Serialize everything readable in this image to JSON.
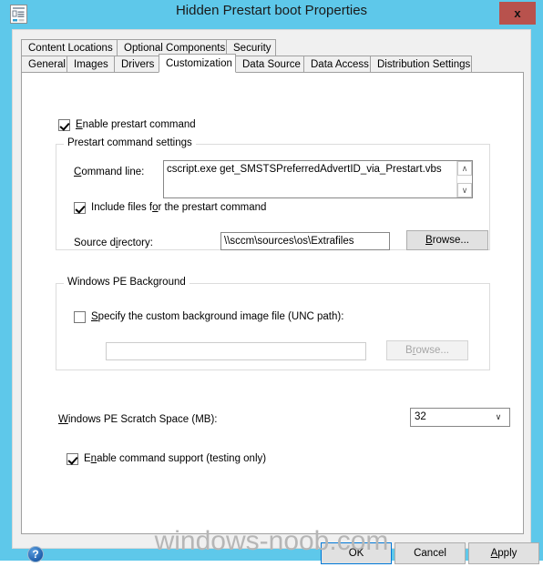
{
  "window": {
    "title": "Hidden Prestart boot Properties",
    "icon": "properties-document-icon",
    "close_label": "x",
    "titlebar_color": "#5ec8ea",
    "close_button_color": "#b8524d"
  },
  "tabs": {
    "row1": [
      {
        "label": "Content Locations",
        "selected": false
      },
      {
        "label": "Optional Components",
        "selected": false
      },
      {
        "label": "Security",
        "selected": false
      }
    ],
    "row2": [
      {
        "label": "General",
        "selected": false
      },
      {
        "label": "Images",
        "selected": false
      },
      {
        "label": "Drivers",
        "selected": false
      },
      {
        "label": "Customization",
        "selected": true
      },
      {
        "label": "Data Source",
        "selected": false
      },
      {
        "label": "Data Access",
        "selected": false
      },
      {
        "label": "Distribution Settings",
        "selected": false
      }
    ]
  },
  "page": {
    "enable_prestart": {
      "label_prefix": "",
      "label_accel": "E",
      "label_rest": "nable prestart command",
      "checked": true
    },
    "prestart_group": {
      "title": "Prestart command settings",
      "command_line": {
        "label_accel": "C",
        "label_rest": "ommand line:",
        "value": "cscript.exe get_SMSTSPreferredAdvertID_via_Prestart.vbs",
        "scroll_up": "∧",
        "scroll_down": "∨"
      },
      "include_files": {
        "label_pre": "Include files f",
        "label_accel": "o",
        "label_rest": "r the prestart command",
        "checked": true
      },
      "source_directory": {
        "label_pre": "Source d",
        "label_accel": "i",
        "label_rest": "rectory:",
        "value": "\\\\sccm\\sources\\os\\Extrafiles"
      },
      "browse_button": {
        "accel": "B",
        "rest": "rowse...",
        "enabled": true
      }
    },
    "winpe_background_group": {
      "title": "Windows PE Background",
      "specify_custom": {
        "label_accel": "S",
        "label_rest": "pecify the custom background image file (UNC path):",
        "checked": false
      },
      "path_field": {
        "value": "",
        "enabled": false
      },
      "browse_button": {
        "pre": "B",
        "accel": "r",
        "rest": "owse...",
        "enabled": false
      }
    },
    "scratch_space": {
      "label_accel": "W",
      "label_rest": "indows PE Scratch Space (MB):",
      "value": "32",
      "arrow": "∨"
    },
    "enable_command_support": {
      "label_pre": "E",
      "label_accel": "n",
      "label_rest": "able command support (testing only)",
      "checked": true
    }
  },
  "footer": {
    "help_glyph": "?",
    "ok": "OK",
    "cancel": "Cancel",
    "apply_accel": "A",
    "apply_rest": "pply"
  },
  "watermark": "windows-noob.com"
}
